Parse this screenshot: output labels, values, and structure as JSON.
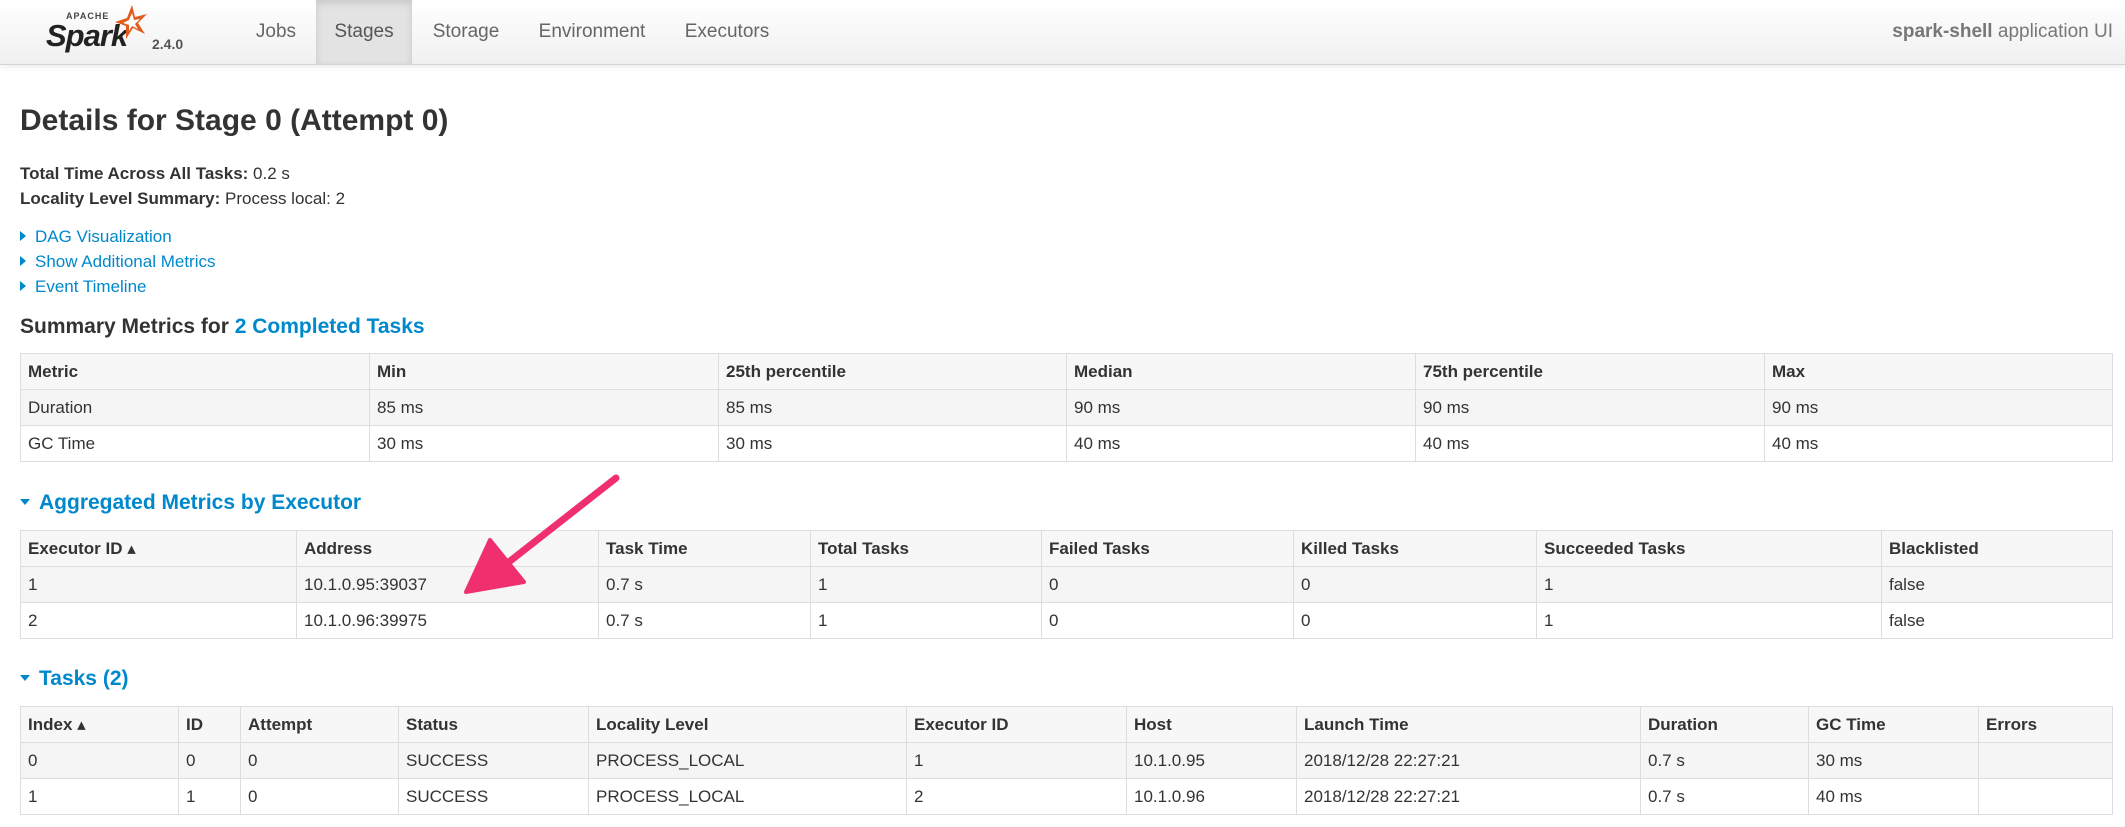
{
  "navbar": {
    "brand_apache": "APACHE",
    "brand_name": "Spark",
    "version": "2.4.0",
    "tabs": [
      {
        "label": "Jobs",
        "active": false
      },
      {
        "label": "Stages",
        "active": true
      },
      {
        "label": "Storage",
        "active": false
      },
      {
        "label": "Environment",
        "active": false
      },
      {
        "label": "Executors",
        "active": false
      }
    ],
    "app_name": "spark-shell",
    "app_suffix": " application UI"
  },
  "page": {
    "title": "Details for Stage 0 (Attempt 0)",
    "total_time_label": "Total Time Across All Tasks:",
    "total_time_value": " 0.2 s",
    "locality_label": "Locality Level Summary:",
    "locality_value": " Process local: 2",
    "links": [
      "DAG Visualization",
      "Show Additional Metrics",
      "Event Timeline"
    ]
  },
  "summary_metrics": {
    "heading_prefix": "Summary Metrics for ",
    "heading_link": "2 Completed Tasks",
    "columns": [
      "Metric",
      "Min",
      "25th percentile",
      "Median",
      "75th percentile",
      "Max"
    ],
    "rows": [
      [
        "Duration",
        "85 ms",
        "85 ms",
        "90 ms",
        "90 ms",
        "90 ms"
      ],
      [
        "GC Time",
        "30 ms",
        "30 ms",
        "40 ms",
        "40 ms",
        "40 ms"
      ]
    ]
  },
  "aggregated": {
    "heading": "Aggregated Metrics by Executor",
    "columns": [
      "Executor ID ▴",
      "Address",
      "Task Time",
      "Total Tasks",
      "Failed Tasks",
      "Killed Tasks",
      "Succeeded Tasks",
      "Blacklisted"
    ],
    "rows": [
      [
        "1",
        "10.1.0.95:39037",
        "0.7 s",
        "1",
        "0",
        "0",
        "1",
        "false"
      ],
      [
        "2",
        "10.1.0.96:39975",
        "0.7 s",
        "1",
        "0",
        "0",
        "1",
        "false"
      ]
    ]
  },
  "tasks": {
    "heading": "Tasks (2)",
    "columns": [
      "Index ▴",
      "ID",
      "Attempt",
      "Status",
      "Locality Level",
      "Executor ID",
      "Host",
      "Launch Time",
      "Duration",
      "GC Time",
      "Errors"
    ],
    "rows": [
      [
        "0",
        "0",
        "0",
        "SUCCESS",
        "PROCESS_LOCAL",
        "1",
        "10.1.0.95",
        "2018/12/28 22:27:21",
        "0.7 s",
        "30 ms",
        ""
      ],
      [
        "1",
        "1",
        "0",
        "SUCCESS",
        "PROCESS_LOCAL",
        "2",
        "10.1.0.96",
        "2018/12/28 22:27:21",
        "0.7 s",
        "40 ms",
        ""
      ]
    ]
  },
  "colors": {
    "link": "#0088cc",
    "annotation_arrow": "#f0306e",
    "spark_star": "#e25a1c"
  }
}
